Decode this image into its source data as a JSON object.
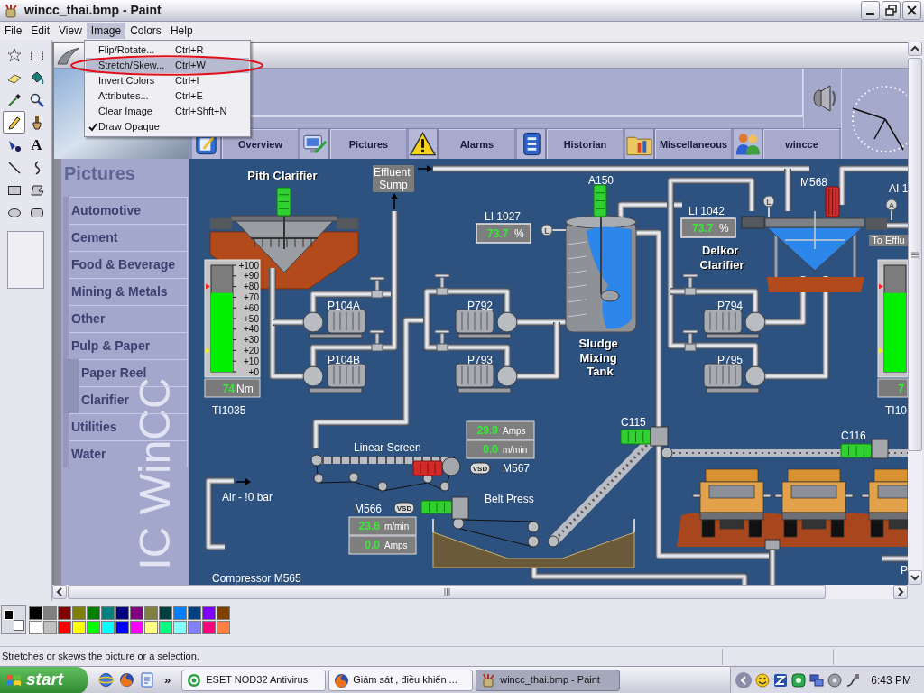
{
  "window": {
    "title": "wincc_thai.bmp - Paint"
  },
  "menu": [
    {
      "label": "File",
      "selected": false
    },
    {
      "label": "Edit",
      "selected": false
    },
    {
      "label": "View",
      "selected": false
    },
    {
      "label": "Image",
      "selected": true
    },
    {
      "label": "Colors",
      "selected": false
    },
    {
      "label": "Help",
      "selected": false
    }
  ],
  "image_menu": [
    {
      "label": "Flip/Rotate...",
      "shortcut": "Ctrl+R",
      "selected": false,
      "checked": false
    },
    {
      "label": "Stretch/Skew...",
      "shortcut": "Ctrl+W",
      "selected": true,
      "checked": false
    },
    {
      "label": "Invert Colors",
      "shortcut": "Ctrl+I",
      "selected": false,
      "checked": false
    },
    {
      "label": "Attributes...",
      "shortcut": "Ctrl+E",
      "selected": false,
      "checked": false
    },
    {
      "label": "Clear Image",
      "shortcut": "Ctrl+Shft+N",
      "selected": false,
      "checked": false
    },
    {
      "label": "Draw Opaque",
      "selected": false,
      "checked": true
    }
  ],
  "toolbox": {
    "tools": [
      {
        "kind": "free-select",
        "selected": false
      },
      {
        "kind": "select",
        "selected": false
      },
      {
        "kind": "eraser",
        "selected": false
      },
      {
        "kind": "fill",
        "selected": false
      },
      {
        "kind": "picker",
        "selected": false
      },
      {
        "kind": "magnifier",
        "selected": false
      },
      {
        "kind": "pencil",
        "selected": true
      },
      {
        "kind": "brush",
        "selected": false
      },
      {
        "kind": "airbrush",
        "selected": false
      },
      {
        "kind": "text",
        "glyph": "A",
        "selected": false
      },
      {
        "kind": "line",
        "selected": false
      },
      {
        "kind": "curve",
        "selected": false
      },
      {
        "kind": "rectangle",
        "selected": false
      },
      {
        "kind": "polygon",
        "selected": false
      },
      {
        "kind": "ellipse",
        "selected": false
      },
      {
        "kind": "rounded-rectangle",
        "selected": false
      }
    ]
  },
  "canvas": {
    "nav": [
      {
        "label": "Overview",
        "kind": "overview"
      },
      {
        "label": "Pictures",
        "kind": "pictures"
      },
      {
        "label": "Alarms",
        "kind": "alarms"
      },
      {
        "label": "Historian",
        "kind": "historian"
      },
      {
        "label": "Miscellaneous",
        "kind": "misc"
      },
      {
        "label": "wincce",
        "kind": "users"
      }
    ],
    "sidebar": {
      "title": "Pictures",
      "items": [
        {
          "label": "Automotive"
        },
        {
          "label": "Cement"
        },
        {
          "label": "Food & Beverage"
        },
        {
          "label": "Mining & Metals"
        },
        {
          "label": "Other"
        },
        {
          "label": "Pulp & Paper",
          "children": [
            {
              "label": "Paper Reel"
            },
            {
              "label": "Clarifier"
            }
          ]
        },
        {
          "label": "Utilities"
        },
        {
          "label": "Water"
        }
      ],
      "logo_text": "IC WinCC"
    },
    "process": {
      "titles": [
        "Pith Clarifier",
        "Delkor Clarifier",
        "Sludge Mixing Tank"
      ],
      "tag_boxes": [
        "Effluent Sump",
        "To Efflu"
      ],
      "labels": [
        "A150",
        "M568",
        "AI 1",
        "P104A",
        "P104B",
        "P792",
        "P793",
        "P794",
        "P795",
        "C115",
        "C116",
        "Linear Screen",
        "M567",
        "Belt Press",
        "M566",
        "Air - !0 bar",
        "Compressor M565",
        "P"
      ],
      "markers": [
        "L",
        "L",
        "A"
      ],
      "vsd": [
        "VSD",
        "VSD"
      ],
      "displays": [
        {
          "tag": "LI 1027",
          "value": "73.7",
          "unit": "%"
        },
        {
          "tag": "LI 1042",
          "value": "73.7",
          "unit": "%"
        }
      ],
      "panels": [
        {
          "rows": [
            {
              "value": "29.9",
              "unit": "Amps"
            },
            {
              "value": "0.0",
              "unit": "m/min"
            }
          ]
        },
        {
          "rows": [
            {
              "value": "23.6",
              "unit": "m/min"
            },
            {
              "value": "0.0",
              "unit": "Amps"
            }
          ]
        }
      ],
      "gauges": [
        {
          "tag": "TI1035",
          "ticks": [
            "+100",
            "+90",
            "+80",
            "+70",
            "+60",
            "+50",
            "+40",
            "+30",
            "+20",
            "+10",
            "+0"
          ],
          "level": 0.74,
          "value": "74",
          "unit": "Nm"
        },
        {
          "tag": "TI10",
          "level": 0.74,
          "value": "7"
        }
      ],
      "motors": [
        {
          "running": true
        },
        {
          "running": true
        },
        {
          "running": false
        },
        {
          "running": false
        },
        {
          "running": true
        },
        {
          "running": true
        },
        {
          "running": true
        }
      ]
    }
  },
  "palette": {
    "current_colors": [
      {
        "color": "#000000"
      },
      {
        "color": "#ffffff"
      }
    ],
    "swatches": [
      {
        "color": "#000000"
      },
      {
        "color": "#808080"
      },
      {
        "color": "#800000"
      },
      {
        "color": "#808000"
      },
      {
        "color": "#008000"
      },
      {
        "color": "#008080"
      },
      {
        "color": "#000080"
      },
      {
        "color": "#800080"
      },
      {
        "color": "#808040"
      },
      {
        "color": "#004040"
      },
      {
        "color": "#0080ff"
      },
      {
        "color": "#004080"
      },
      {
        "color": "#8000ff"
      },
      {
        "color": "#804000"
      },
      {
        "color": "#ffffff"
      },
      {
        "color": "#c0c0c0"
      },
      {
        "color": "#ff0000"
      },
      {
        "color": "#ffff00"
      },
      {
        "color": "#00ff00"
      },
      {
        "color": "#00ffff"
      },
      {
        "color": "#0000ff"
      },
      {
        "color": "#ff00ff"
      },
      {
        "color": "#ffff80"
      },
      {
        "color": "#00ff80"
      },
      {
        "color": "#80ffff"
      },
      {
        "color": "#8080ff"
      },
      {
        "color": "#ff0080"
      },
      {
        "color": "#ff8040"
      }
    ]
  },
  "status_bar": {
    "text": "Stretches or skews the picture or a selection."
  },
  "taskbar": {
    "start": "start",
    "more": "»",
    "tasks": [
      {
        "label": "ESET NOD32 Antivirus",
        "kind": "antivirus",
        "selected": false
      },
      {
        "label": "Giám sát , điều khiển ...",
        "kind": "browser",
        "selected": false
      },
      {
        "label": "wincc_thai.bmp - Paint",
        "kind": "paint",
        "selected": true
      }
    ],
    "clock": "6:43 PM"
  }
}
